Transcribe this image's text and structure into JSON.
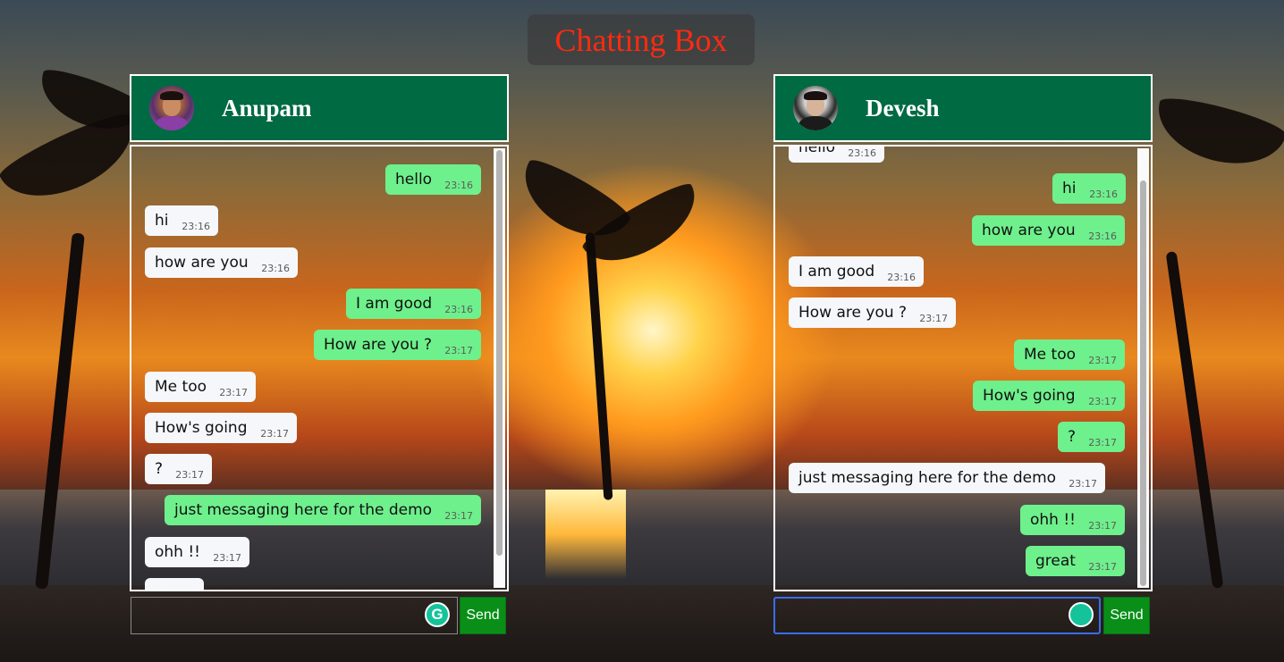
{
  "app": {
    "title": "Chatting Box"
  },
  "left_chat": {
    "name": "Anupam",
    "messages": [
      {
        "dir": "sent",
        "text": "hello",
        "time": "23:16"
      },
      {
        "dir": "recv",
        "text": "hi",
        "time": "23:16"
      },
      {
        "dir": "recv",
        "text": "how are you",
        "time": "23:16"
      },
      {
        "dir": "sent",
        "text": "I am good",
        "time": "23:16"
      },
      {
        "dir": "sent",
        "text": "How are you ?",
        "time": "23:17"
      },
      {
        "dir": "recv",
        "text": "Me too",
        "time": "23:17"
      },
      {
        "dir": "recv",
        "text": "How's going",
        "time": "23:17"
      },
      {
        "dir": "recv",
        "text": "?",
        "time": "23:17"
      },
      {
        "dir": "sent",
        "text": "just messaging here for the demo",
        "time": "23:17"
      },
      {
        "dir": "recv",
        "text": "ohh !!",
        "time": "23:17"
      },
      {
        "dir": "recv",
        "text": "",
        "time": ""
      }
    ],
    "input": {
      "value": "",
      "placeholder": ""
    },
    "send_label": "Send",
    "grammar_icon": "grammarly-icon",
    "grammar_glyph": "G"
  },
  "right_chat": {
    "name": "Devesh",
    "messages": [
      {
        "dir": "recv",
        "text": "hello",
        "time": "23:16"
      },
      {
        "dir": "sent",
        "text": "hi",
        "time": "23:16"
      },
      {
        "dir": "sent",
        "text": "how are you",
        "time": "23:16"
      },
      {
        "dir": "recv",
        "text": "I am good",
        "time": "23:16"
      },
      {
        "dir": "recv",
        "text": "How are you ?",
        "time": "23:17"
      },
      {
        "dir": "sent",
        "text": "Me too",
        "time": "23:17"
      },
      {
        "dir": "sent",
        "text": "How's going",
        "time": "23:17"
      },
      {
        "dir": "sent",
        "text": "?",
        "time": "23:17"
      },
      {
        "dir": "recv",
        "text": "just messaging here for the demo",
        "time": "23:17"
      },
      {
        "dir": "sent",
        "text": "ohh !!",
        "time": "23:17"
      },
      {
        "dir": "sent",
        "text": "great",
        "time": "23:17"
      }
    ],
    "input": {
      "value": "",
      "placeholder": ""
    },
    "send_label": "Send",
    "grammar_icon": "grammarly-icon"
  },
  "colors": {
    "title_text": "#ff2a10",
    "header_bg": "#006a43",
    "sent_bubble": "#6ef08c",
    "recv_bubble": "#f6f7fb",
    "send_button": "#098f18"
  }
}
